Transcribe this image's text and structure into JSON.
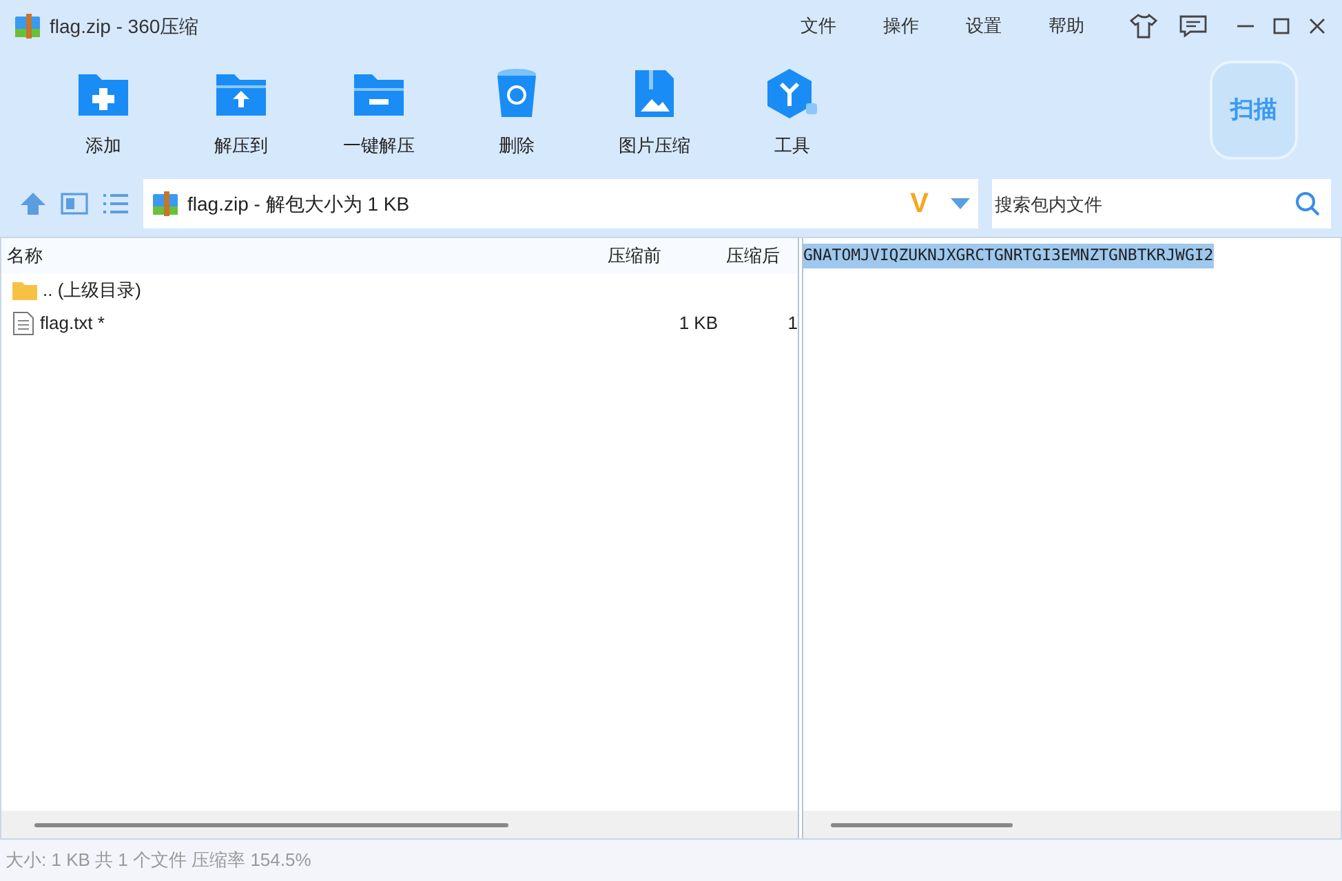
{
  "window": {
    "title": "flag.zip - 360压缩"
  },
  "menu": [
    "文件",
    "操作",
    "设置",
    "帮助"
  ],
  "toolbar": [
    {
      "label": "添加",
      "kind": "add"
    },
    {
      "label": "解压到",
      "kind": "extract"
    },
    {
      "label": "一键解压",
      "kind": "oneclick"
    },
    {
      "label": "删除",
      "kind": "delete"
    },
    {
      "label": "图片压缩",
      "kind": "image"
    },
    {
      "label": "工具",
      "kind": "tools"
    }
  ],
  "scan_button": "扫描",
  "address": {
    "path": "flag.zip - 解包大小为 1 KB",
    "badge": "V"
  },
  "search": {
    "placeholder": "搜索包内文件"
  },
  "table": {
    "columns": [
      "名称",
      "压缩前",
      "压缩后"
    ],
    "rows": [
      {
        "kind": "folder",
        "name": ".. (上级目录)",
        "size": "",
        "packed": "",
        "selected": false
      },
      {
        "kind": "file",
        "name": "flag.txt *",
        "size": "1 KB",
        "packed": "1",
        "selected": false
      }
    ]
  },
  "preview": {
    "text": "GNATOMJVIQZUKNJXGRCTGNRTGI3EMNZTGNBTKRJWGI2",
    "selected": true
  },
  "status_bar": "大小: 1 KB 共 1 个文件 压缩率 154.5%"
}
